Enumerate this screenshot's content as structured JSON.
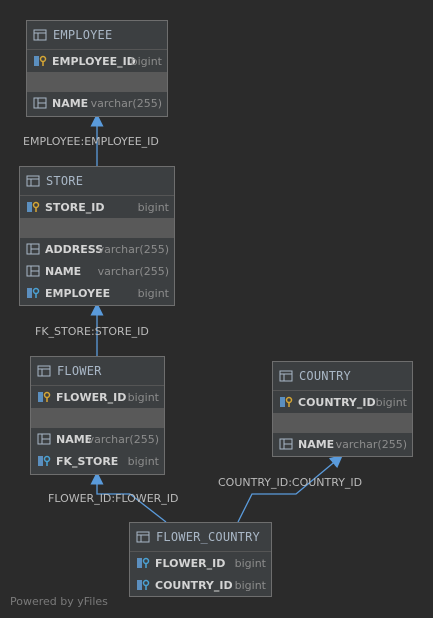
{
  "tables": {
    "employee": {
      "title": "EMPLOYEE",
      "pk": [
        {
          "name": "EMPLOYEE_ID",
          "type": "bigint"
        }
      ],
      "cols": [
        {
          "name": "NAME",
          "type": "varchar(255)"
        }
      ]
    },
    "store": {
      "title": "STORE",
      "pk": [
        {
          "name": "STORE_ID",
          "type": "bigint"
        }
      ],
      "cols": [
        {
          "name": "ADDRESS",
          "type": "varchar(255)"
        },
        {
          "name": "NAME",
          "type": "varchar(255)"
        },
        {
          "name": "EMPLOYEE",
          "type": "bigint"
        }
      ]
    },
    "flower": {
      "title": "FLOWER",
      "pk": [
        {
          "name": "FLOWER_ID",
          "type": "bigint"
        }
      ],
      "cols": [
        {
          "name": "NAME",
          "type": "varchar(255)"
        },
        {
          "name": "FK_STORE",
          "type": "bigint"
        }
      ]
    },
    "country": {
      "title": "COUNTRY",
      "pk": [
        {
          "name": "COUNTRY_ID",
          "type": "bigint"
        }
      ],
      "cols": [
        {
          "name": "NAME",
          "type": "varchar(255)"
        }
      ]
    },
    "flower_country": {
      "title": "FLOWER_COUNTRY",
      "cols": [
        {
          "name": "FLOWER_ID",
          "type": "bigint"
        },
        {
          "name": "COUNTRY_ID",
          "type": "bigint"
        }
      ]
    }
  },
  "relations": {
    "store_employee": "EMPLOYEE:EMPLOYEE_ID",
    "flower_store": "FK_STORE:STORE_ID",
    "fc_flower": "FLOWER_ID:FLOWER_ID",
    "fc_country": "COUNTRY_ID:COUNTRY_ID"
  },
  "footer": "Powered by yFiles",
  "colors": {
    "background": "#2b2b2b",
    "table_bg": "#3c3f41",
    "edge": "#5a9bdc",
    "key_icon": "#d6a735"
  }
}
